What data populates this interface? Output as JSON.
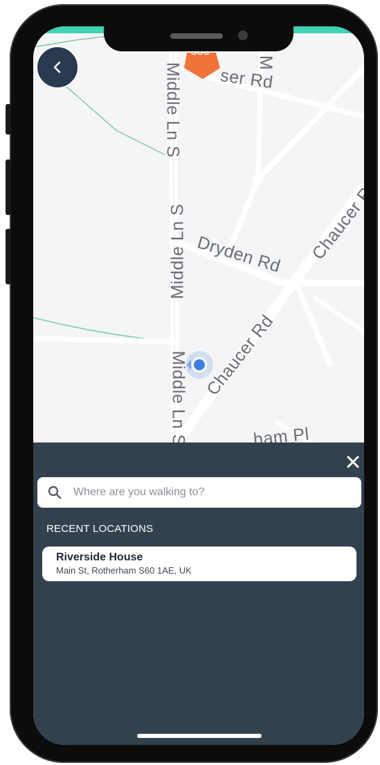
{
  "map": {
    "roads": {
      "middle_ln_s_top": "Middle Ln S",
      "middle_ln_s_mid": "Middle Ln S",
      "middle_ln_s_bottom": "Middle Ln S",
      "dryden_rd": "Dryden Rd",
      "chaucer_rd_main": "Chaucer Rd",
      "chaucer_rd_top": "Chaucer R",
      "spenser_rd_fragment": "ser Rd",
      "place_fragment": "ham Pl",
      "m_fragment": "M"
    },
    "poi_badge_text": "SOS",
    "colors": {
      "road": "#ffffff",
      "background": "#f4f5f6",
      "park_line": "#7dc9a8",
      "location_dot": "#3f7fe0",
      "poi": "#f0743a"
    }
  },
  "search": {
    "placeholder": "Where are you walking to?",
    "value": ""
  },
  "recent": {
    "title": "RECENT LOCATIONS",
    "items": [
      {
        "name": "Riverside House",
        "address": "Main St, Rotherham S60 1AE, UK"
      }
    ]
  },
  "colors": {
    "panel": "#33414f",
    "accent": "#3fd2b5",
    "back_button": "#2a3a4e"
  }
}
